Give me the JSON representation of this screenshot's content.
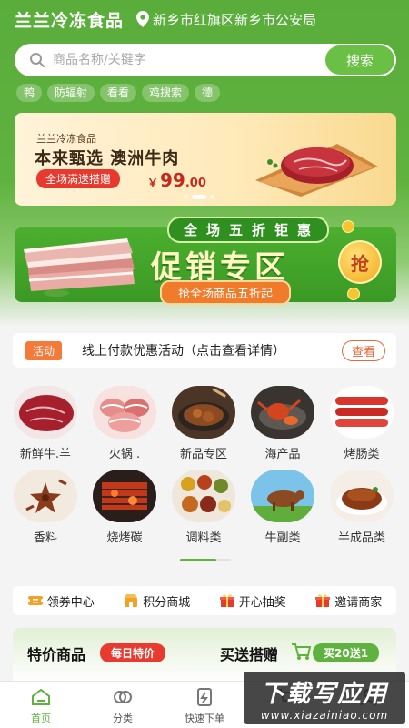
{
  "header": {
    "app_title": "兰兰冷冻食品",
    "location": "新乡市红旗区新乡市公安局",
    "location_icon": "location-pin-icon"
  },
  "search": {
    "placeholder": "商品名称/关键字",
    "button_label": "搜索"
  },
  "hot_tags": [
    "鸭",
    "防辐射",
    "看看",
    "鸡搜索",
    "德"
  ],
  "banner_main": {
    "brand": "兰兰冷冻食品",
    "title": "本来甄选 澳洲牛肉",
    "pill": "全场满送搭赠",
    "price_symbol": "￥",
    "price_int": "99",
    "price_dec": ".00",
    "dots": 3,
    "active_dot": 1
  },
  "banner_promo": {
    "top_text": "全场五折钜惠",
    "title": "促销专区",
    "subtitle": "抢全场商品五折起",
    "grab_label": "抢"
  },
  "activity": {
    "badge": "活动",
    "text": "线上付款优惠活动（点击查看详情）",
    "button": "查看"
  },
  "categories": [
    {
      "label": "新鲜牛.羊"
    },
    {
      "label": "火锅 ."
    },
    {
      "label": "新品专区"
    },
    {
      "label": "海产品"
    },
    {
      "label": "烤肠类"
    },
    {
      "label": "香料"
    },
    {
      "label": "烧烤碳"
    },
    {
      "label": "调料类"
    },
    {
      "label": "牛副类"
    },
    {
      "label": "半成品类"
    }
  ],
  "quick_links": [
    {
      "label": "领券中心",
      "icon": "coupon-icon"
    },
    {
      "label": "积分商城",
      "icon": "points-mall-icon"
    },
    {
      "label": "开心抽奖",
      "icon": "gift-icon"
    },
    {
      "label": "邀请商家",
      "icon": "invite-gift-icon"
    }
  ],
  "special": {
    "title": "特价商品",
    "badge": "每日特价",
    "title2": "买送搭赠",
    "badge2": "买20送1"
  },
  "nav": [
    {
      "label": "首页",
      "icon": "home-icon",
      "active": true
    },
    {
      "label": "分类",
      "icon": "category-icon",
      "active": false
    },
    {
      "label": "快速下单",
      "icon": "quick-order-icon",
      "active": false
    },
    {
      "label": "",
      "icon": "cart-icon",
      "active": false
    },
    {
      "label": "",
      "icon": "user-icon",
      "active": false
    }
  ],
  "watermark": {
    "main": "下载写应用",
    "sub": "www.xiazainiao.com"
  },
  "colors": {
    "brand_green": "#5fb23e",
    "accent_red": "#e83a2e",
    "accent_orange": "#f47a3a"
  }
}
